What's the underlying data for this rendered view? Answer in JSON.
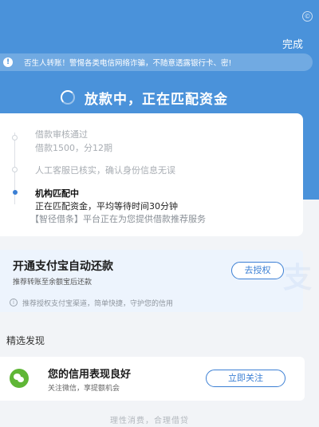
{
  "colors": {
    "primary": "#4a92da",
    "accent": "#3b7fd4",
    "wechat": "#5fb636",
    "page_bg": "#f2f4f7"
  },
  "status_bar": {
    "left_text": "",
    "right_text": ""
  },
  "header": {
    "done_label": "完成"
  },
  "notice": {
    "icon": "warning-icon",
    "text": "否生人转账！警惕各类电信网络诈骗，不随意透露银行卡、密!"
  },
  "loan_status": {
    "icon": "spinner-icon",
    "title": "放款中，正在匹配资金"
  },
  "timeline": {
    "steps": [
      {
        "title": "借款审核通过",
        "detail": "借款1500，分12期"
      },
      {
        "title": "人工客服已核实，确认身份信息无误"
      },
      {
        "title": "机构匹配中",
        "detail": "正在匹配资金，平均等待时间30分钟",
        "note": "【智径借条】平台正在为您提供借款推荐服务"
      }
    ]
  },
  "alipay": {
    "title": "开通支付宝自动还款",
    "subtitle": "推荐转账至余额宝后还款",
    "button_label": "去授权",
    "tip": "推荐授权支付宝渠道，简单快捷，守护您的信用",
    "watermark": "支"
  },
  "discover": {
    "section_title": "精选发现"
  },
  "wechat": {
    "icon": "wechat-icon",
    "title": "您的信用表现良好",
    "subtitle": "关注微信，享提额机会",
    "button_label": "立即关注"
  },
  "footer": {
    "text": "理性消费，合理借贷"
  }
}
